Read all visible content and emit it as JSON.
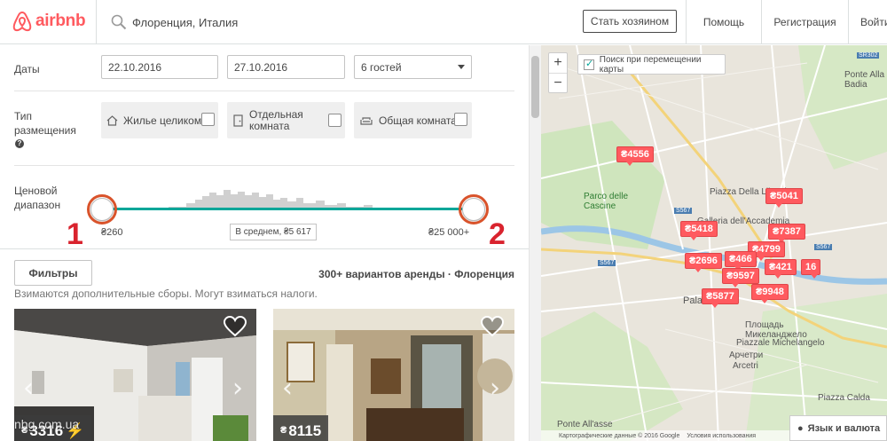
{
  "header": {
    "logo_text": "airbnb",
    "search_value": "Флоренция, Италия",
    "host_button": "Стать хозяином",
    "nav": [
      "Помощь",
      "Регистрация",
      "Войти"
    ]
  },
  "filters_panel": {
    "dates_label": "Даты",
    "checkin": "22.10.2016",
    "checkout": "27.10.2016",
    "guests": "6 гостей",
    "room_type_label": "Тип размещения",
    "room_types": [
      "Жилье целиком",
      "Отдельная комната",
      "Общая комната"
    ],
    "price_label": "Ценовой диапазон",
    "price_min": "₴260",
    "price_max": "₴25 000+",
    "price_avg": "В среднем, ₴5 617",
    "annotation_1": "1",
    "annotation_2": "2"
  },
  "results_bar": {
    "filters_button": "Фильтры",
    "results_text": "300+ вариантов аренды · Флоренция",
    "fees_note": "Взимаются дополнительные сборы. Могут взиматься налоги."
  },
  "listings": [
    {
      "currency": "₴",
      "price": "3316"
    },
    {
      "currency": "₴",
      "price": "8115"
    }
  ],
  "watermark": "nbg.com.ua",
  "map": {
    "search_checkbox": "Поиск при перемещении карты",
    "zoom_in": "+",
    "zoom_out": "−",
    "labels": [
      "Piazza Della Libertà",
      "Parco delle Cascine",
      "Ponte Alla Badia",
      "Площадь Микеланджело",
      "Piazzale Michelangelo",
      "Арчетри",
      "Arcetri",
      "Piazza Calda",
      "Ponte All'asse",
      "Palazzo",
      "Galleria dell'Accademia"
    ],
    "pins": [
      "₴4556",
      "₴5041",
      "₴5418",
      "₴7387",
      "₴4799",
      "₴2696",
      "₴466",
      "₴421",
      "16",
      "₴9597",
      "₴5877",
      "₴9948"
    ],
    "footer_data": "Картографические данные © 2016 Google",
    "footer_terms": "Условия использования",
    "language_button": "Язык и валюта"
  }
}
